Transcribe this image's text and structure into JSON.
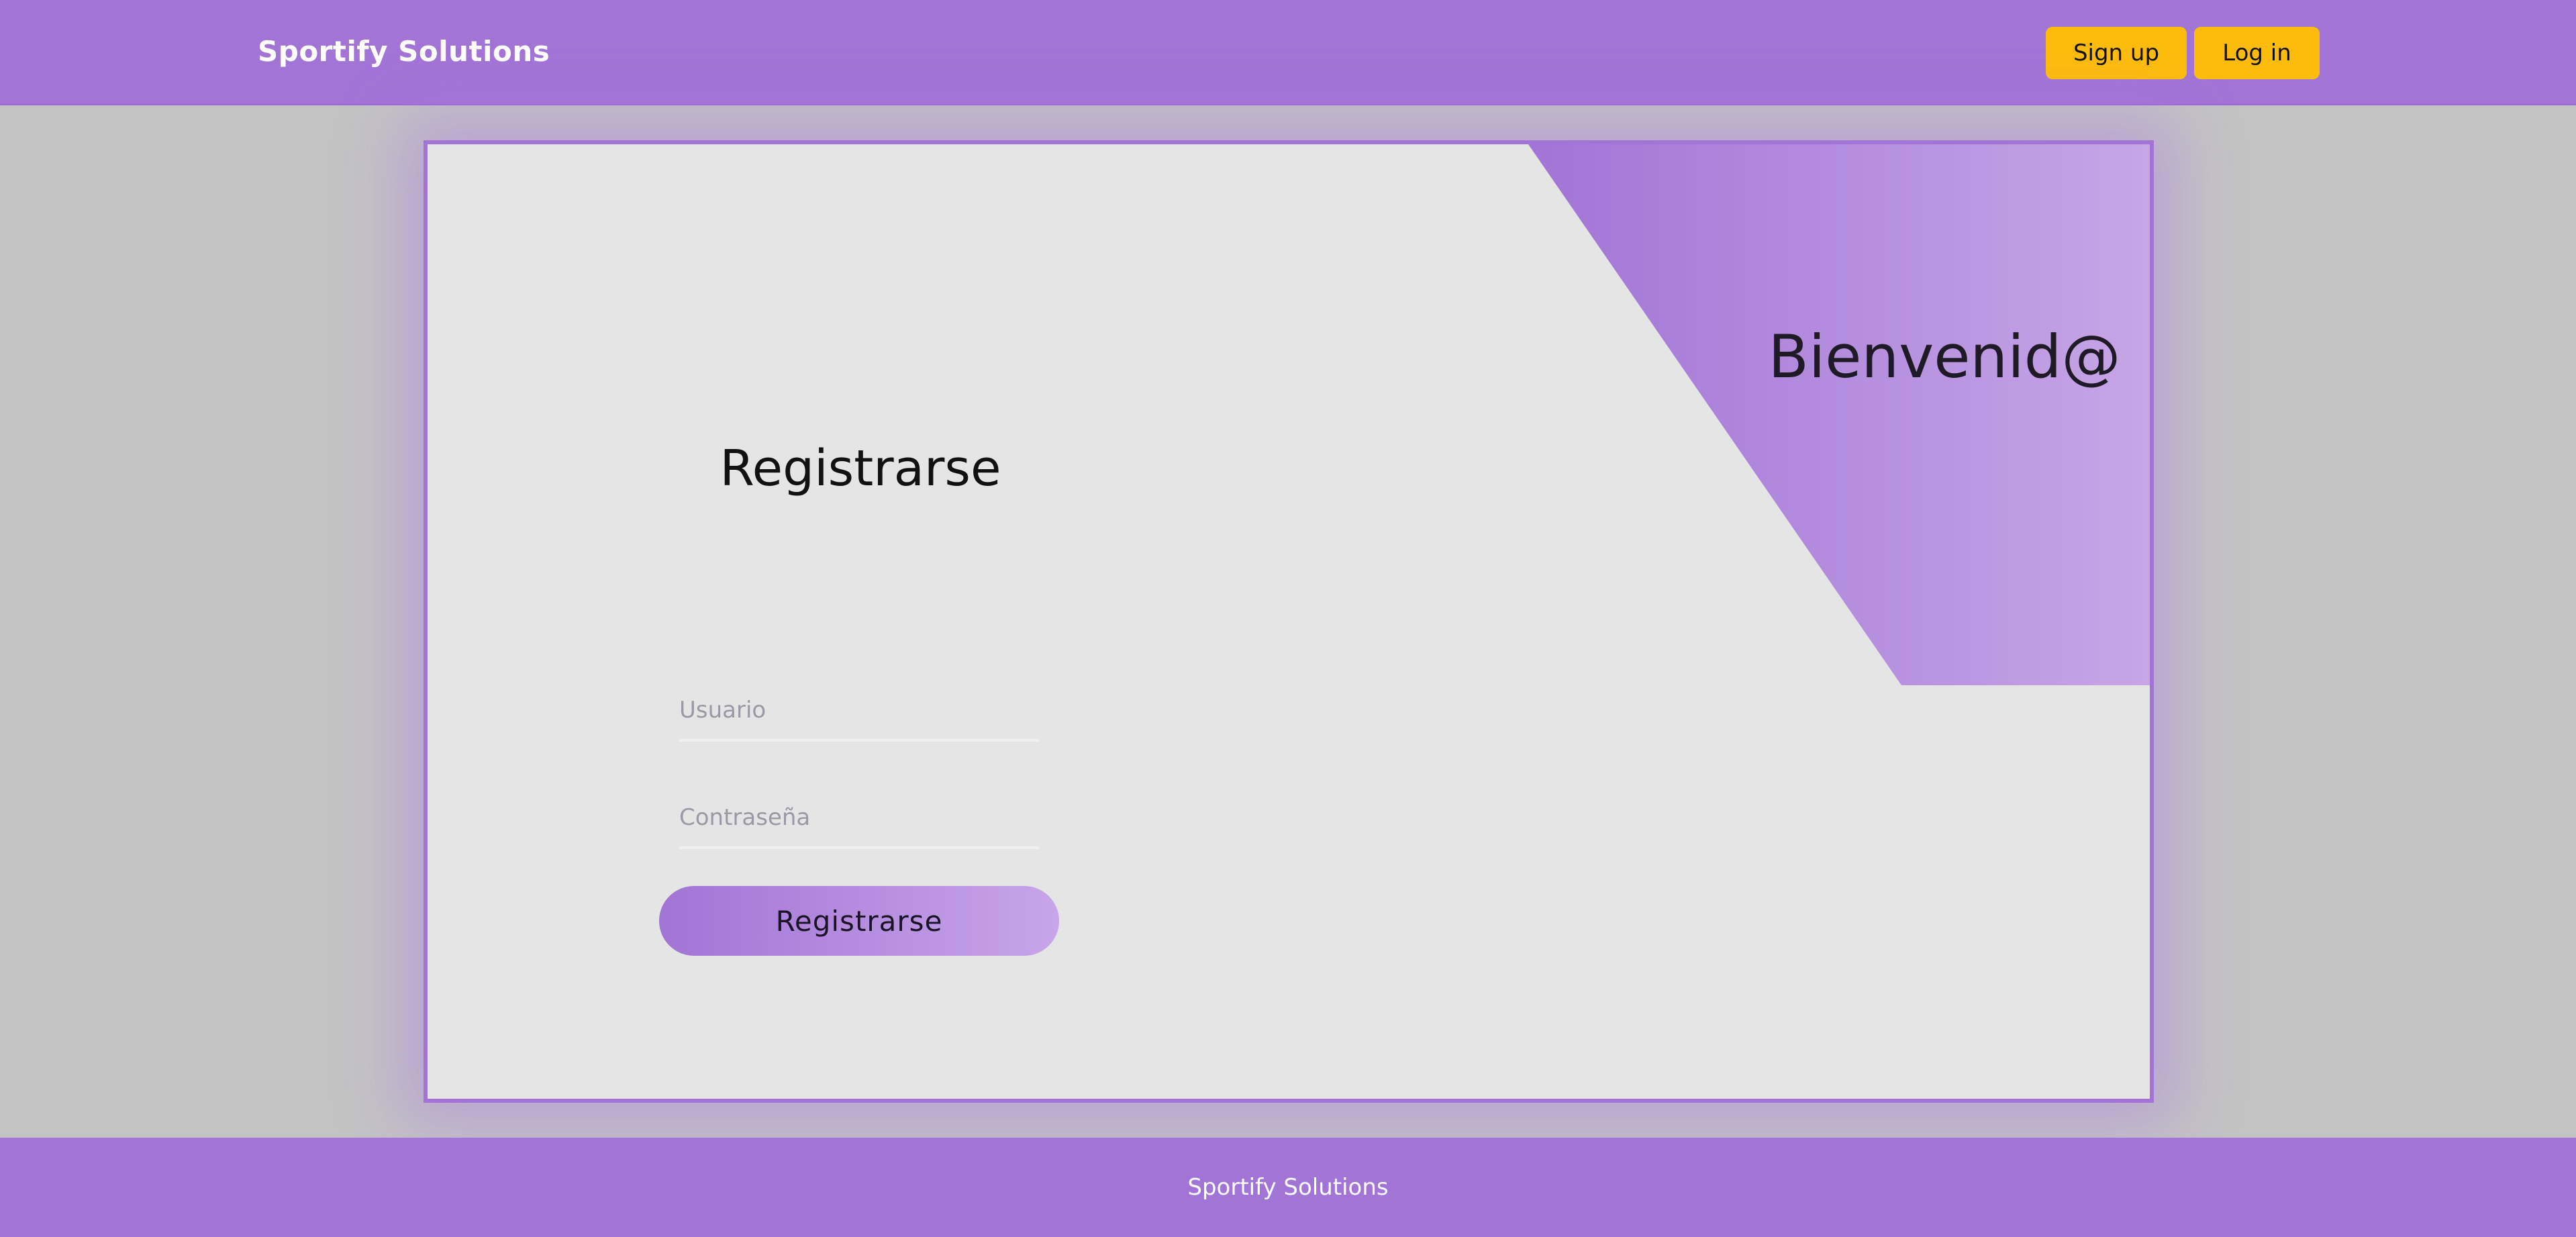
{
  "header": {
    "brand": "Sportify Solutions",
    "signup_label": "Sign up",
    "login_label": "Log in"
  },
  "welcome": {
    "title": "Bienvenid@"
  },
  "form": {
    "title": "Registrarse",
    "username_placeholder": "Usuario",
    "password_placeholder": "Contraseña",
    "submit_label": "Registrarse"
  },
  "footer": {
    "text": "Sportify Solutions"
  },
  "colors": {
    "accent": "#a274d6",
    "button": "#fdbc0c",
    "background": "#c3c3c3",
    "card": "#e5e5e5"
  }
}
